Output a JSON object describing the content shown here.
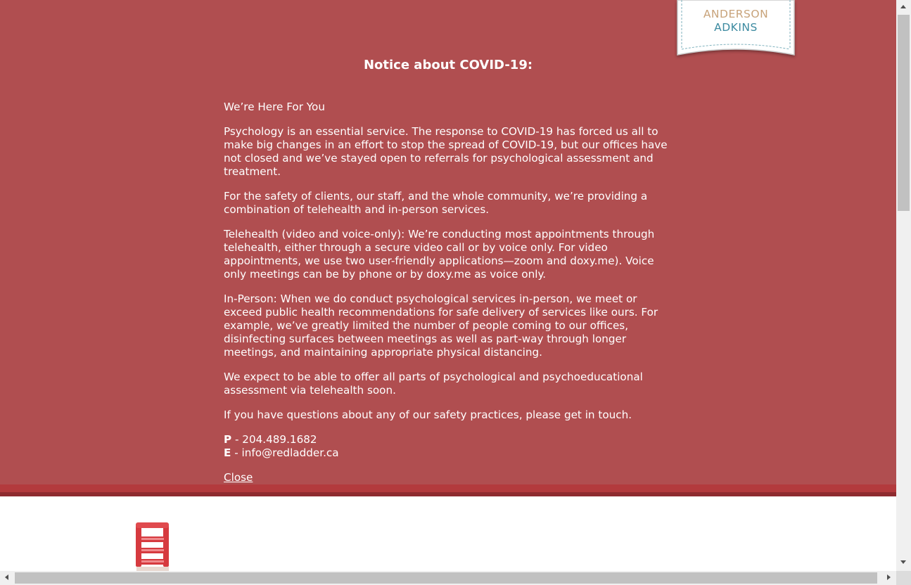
{
  "colors": {
    "notice_background": "#b04e50",
    "notice_text": "#ffffff",
    "band_top": "#b33a3d",
    "band_bottom": "#8e2b2f",
    "badge_gold": "#c8a37a",
    "badge_teal": "#3c8aa0",
    "ladder_red": "#d63a3f"
  },
  "badge": {
    "line1": "ANDERSON",
    "line2": "ADKINS"
  },
  "notice": {
    "title": "Notice about COVID-19:",
    "paragraphs": [
      "We’re Here For You",
      "Psychology is an essential service. The response to COVID-19 has forced us all to make big changes in an effort to stop the spread of COVID-19, but our offices have not closed and we’ve stayed open to referrals for psychological assessment and treatment.",
      "For the safety of clients, our staff, and the whole community, we’re providing a combination of telehealth and in-person services.",
      "Telehealth (video and voice-only): We’re conducting most appointments through telehealth, either through a secure video call or by voice only. For video appointments, we use two user-friendly applications—zoom and doxy.me). Voice only meetings can be by phone or by doxy.me as voice only.",
      "In-Person: When we do conduct psychological services in-person, we meet or exceed public health recommendations for safe delivery of services like ours. For example, we’ve greatly limited the number of people coming to our offices, disinfecting surfaces between meetings as well as part-way through longer meetings, and maintaining appropriate physical distancing.",
      "We expect to be able to offer all parts of psychological and psychoeducational assessment via telehealth soon.",
      "If you have questions about any of our safety practices, please get in touch."
    ],
    "phone_label": "P",
    "phone_value": " - 204.489.1682",
    "email_label": "E",
    "email_value": " - info@redladder.ca",
    "close_label": "Close"
  },
  "icons": {
    "logo": "ladder-logo-icon",
    "scroll_up": "chevron-up-icon",
    "scroll_down": "chevron-down-icon",
    "scroll_left": "chevron-left-icon",
    "scroll_right": "chevron-right-icon"
  }
}
